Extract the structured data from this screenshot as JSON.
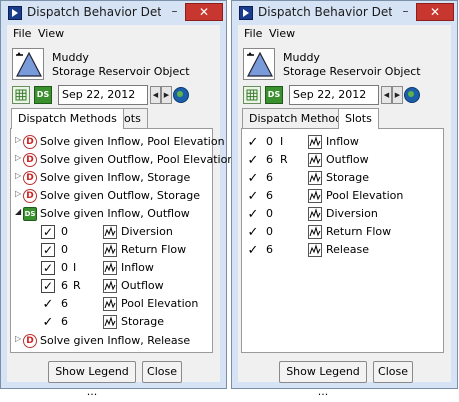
{
  "left_window": {
    "title": "Dispatch Behavior Det",
    "menu": [
      "File",
      "View"
    ],
    "object": {
      "name": "Muddy",
      "type": "Storage Reservoir Object"
    },
    "date": "Sep 22, 2012",
    "ds_label": "DS",
    "tabs": [
      "Dispatch Methods",
      "Slots"
    ],
    "active_tab": "Dispatch Methods",
    "methods": [
      {
        "label": "Solve given Inflow, Pool Elevation",
        "icon": "D"
      },
      {
        "label": "Solve given Outflow, Pool Elevation",
        "icon": "D"
      },
      {
        "label": "Solve given Inflow, Storage",
        "icon": "D"
      },
      {
        "label": "Solve given Outflow, Storage",
        "icon": "D"
      },
      {
        "label": "Solve given Inflow, Outflow",
        "icon": "DS",
        "expanded": true,
        "slots": [
          {
            "check": "box",
            "count": "0",
            "flag": "",
            "name": "Diversion"
          },
          {
            "check": "box",
            "count": "0",
            "flag": "",
            "name": "Return Flow"
          },
          {
            "check": "box",
            "count": "0",
            "flag": "I",
            "name": "Inflow"
          },
          {
            "check": "box",
            "count": "6",
            "flag": "R",
            "name": "Outflow"
          },
          {
            "check": "mark",
            "count": "6",
            "flag": "",
            "name": "Pool Elevation"
          },
          {
            "check": "mark",
            "count": "6",
            "flag": "",
            "name": "Storage"
          }
        ]
      },
      {
        "label": "Solve given Inflow, Release",
        "icon": "D"
      }
    ],
    "buttons": {
      "legend": "Show Legend ...",
      "close": "Close"
    }
  },
  "right_window": {
    "title": "Dispatch Behavior Det",
    "menu": [
      "File",
      "View"
    ],
    "object": {
      "name": "Muddy",
      "type": "Storage Reservoir Object"
    },
    "date": "Sep 22, 2012",
    "ds_label": "DS",
    "tabs": [
      "Dispatch Methods",
      "Slots"
    ],
    "active_tab": "Slots",
    "slots": [
      {
        "count": "0",
        "flag": "I",
        "name": "Inflow"
      },
      {
        "count": "6",
        "flag": "R",
        "name": "Outflow"
      },
      {
        "count": "6",
        "flag": "",
        "name": "Storage"
      },
      {
        "count": "6",
        "flag": "",
        "name": "Pool Elevation"
      },
      {
        "count": "0",
        "flag": "",
        "name": "Diversion"
      },
      {
        "count": "0",
        "flag": "",
        "name": "Return Flow"
      },
      {
        "count": "6",
        "flag": "",
        "name": "Release"
      }
    ],
    "buttons": {
      "legend": "Show Legend ...",
      "close": "Close"
    }
  },
  "window_controls": {
    "minimize": "–",
    "close": "✕"
  },
  "glyphs": {
    "checkmark": "✓",
    "expand": "▷",
    "collapse": "◢",
    "prev": "◀",
    "next": "▶"
  },
  "colors": {
    "title_bar": "#d6e3f4",
    "close_button": "#c7372f",
    "ds_green": "#3a8f2e",
    "reservoir_blue": "#7a9bd9"
  }
}
